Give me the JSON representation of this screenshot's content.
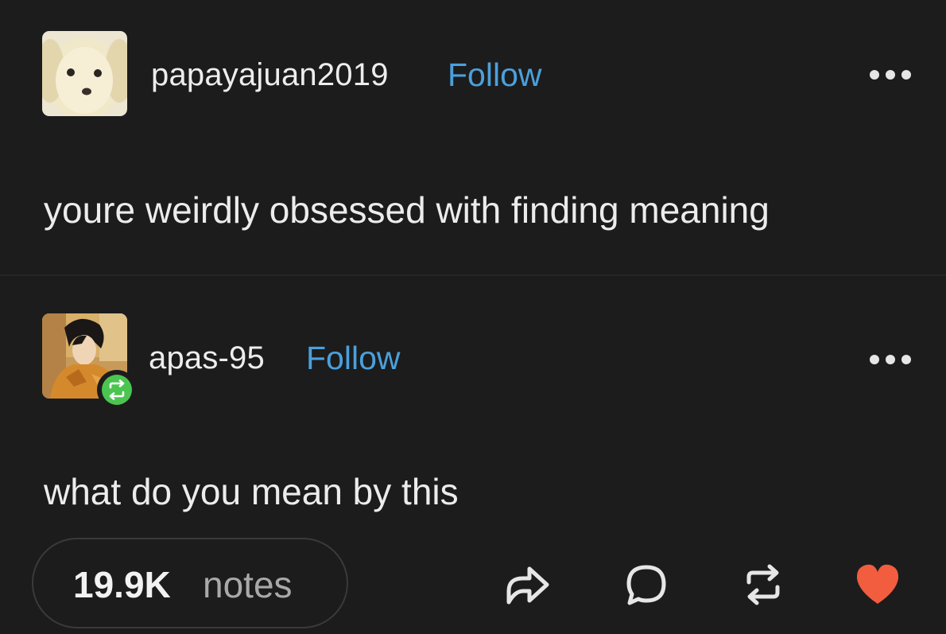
{
  "posts": [
    {
      "username": "papayajuan2019",
      "follow_label": "Follow",
      "text": "youre weirdly obsessed with finding meaning",
      "avatar": "puppy-avatar"
    },
    {
      "username": "apas-95",
      "follow_label": "Follow",
      "text": "what do you mean by this",
      "avatar": "anime-character-avatar",
      "badge": "reblog-badge-icon"
    }
  ],
  "footer": {
    "notes_count": "19.9K",
    "notes_label": "notes",
    "actions": [
      "share-icon",
      "reply-icon",
      "reblog-icon",
      "like-icon"
    ]
  },
  "colors": {
    "background": "#1c1c1c",
    "follow": "#4ba0dc",
    "like": "#f25c3f",
    "reblog_badge": "#4bc550"
  }
}
